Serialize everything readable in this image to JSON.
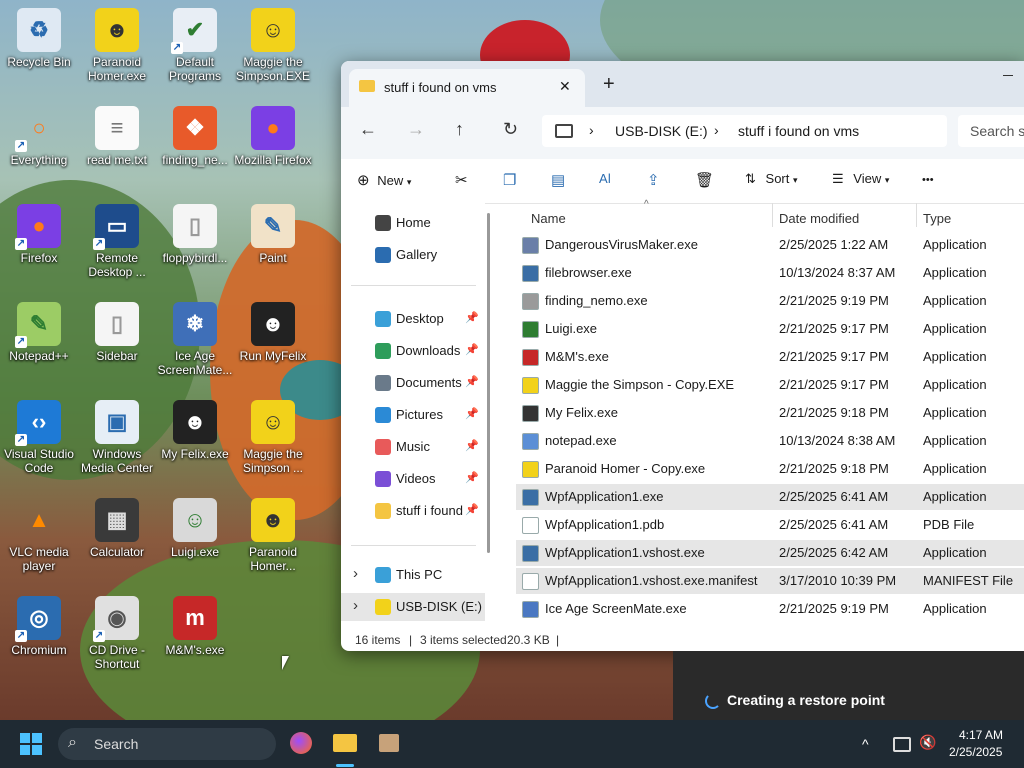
{
  "desktop": {
    "icons": [
      {
        "label": "Recycle Bin",
        "icon": "recycle-bin-icon"
      },
      {
        "label": "Paranoid Homer.exe",
        "icon": "homer-icon"
      },
      {
        "label": "Default Programs",
        "icon": "default-programs-icon"
      },
      {
        "label": "Maggie the Simpson.EXE",
        "icon": "maggie-icon"
      },
      {
        "label": "Everything",
        "icon": "magnifier-icon"
      },
      {
        "label": "read me.txt",
        "icon": "text-file-icon"
      },
      {
        "label": "finding_ne...",
        "icon": "nemo-icon"
      },
      {
        "label": "Mozilla Firefox",
        "icon": "firefox-icon"
      },
      {
        "label": "Firefox",
        "icon": "firefox-icon"
      },
      {
        "label": "Remote Desktop ...",
        "icon": "remote-desktop-icon"
      },
      {
        "label": "floppybirdl...",
        "icon": "file-icon"
      },
      {
        "label": "Paint",
        "icon": "paint-icon"
      },
      {
        "label": "Notepad++",
        "icon": "notepadpp-icon"
      },
      {
        "label": "Sidebar",
        "icon": "file-icon"
      },
      {
        "label": "Ice Age ScreenMate...",
        "icon": "ice-age-icon"
      },
      {
        "label": "Run MyFelix",
        "icon": "felix-icon"
      },
      {
        "label": "Visual Studio Code",
        "icon": "vscode-icon"
      },
      {
        "label": "Windows Media Center",
        "icon": "media-center-icon"
      },
      {
        "label": "My Felix.exe",
        "icon": "felix-icon"
      },
      {
        "label": "Maggie the Simpson ...",
        "icon": "maggie-icon"
      },
      {
        "label": "VLC media player",
        "icon": "vlc-icon"
      },
      {
        "label": "Calculator",
        "icon": "calculator-icon"
      },
      {
        "label": "Luigi.exe",
        "icon": "luigi-icon"
      },
      {
        "label": "Paranoid Homer...",
        "icon": "homer-icon"
      },
      {
        "label": "Chromium",
        "icon": "chromium-icon"
      },
      {
        "label": "CD Drive - Shortcut",
        "icon": "cd-drive-icon"
      },
      {
        "label": "M&M's.exe",
        "icon": "mms-icon"
      }
    ]
  },
  "explorer": {
    "tab_title": "stuff i found on vms",
    "tab_close": "✕",
    "new_tab": "+",
    "breadcrumb": [
      "USB-DISK (E:)",
      "stuff i found on vms"
    ],
    "search_placeholder": "Search st",
    "commands": {
      "new": "New",
      "sort": "Sort",
      "view": "View",
      "more": "•••"
    },
    "nav": [
      {
        "label": "Home",
        "pinned": false
      },
      {
        "label": "Gallery",
        "pinned": false
      },
      {
        "label": "Desktop",
        "pinned": true
      },
      {
        "label": "Downloads",
        "pinned": true
      },
      {
        "label": "Documents",
        "pinned": true
      },
      {
        "label": "Pictures",
        "pinned": true
      },
      {
        "label": "Music",
        "pinned": true
      },
      {
        "label": "Videos",
        "pinned": true
      },
      {
        "label": "stuff i found",
        "pinned": true
      },
      {
        "label": "This PC",
        "pinned": false
      },
      {
        "label": "USB-DISK (E:)",
        "pinned": false
      }
    ],
    "columns": {
      "name": "Name",
      "date": "Date modified",
      "type": "Type"
    },
    "files": [
      {
        "name": "DangerousVirusMaker.exe",
        "date": "2/25/2025 1:22 AM",
        "type": "Application",
        "selected": false,
        "color": "#6a7fa8"
      },
      {
        "name": "filebrowser.exe",
        "date": "10/13/2024 8:37 AM",
        "type": "Application",
        "selected": false,
        "color": "#3a6ea5"
      },
      {
        "name": "finding_nemo.exe",
        "date": "2/21/2025 9:19 PM",
        "type": "Application",
        "selected": false,
        "color": "#9a9a9a"
      },
      {
        "name": "Luigi.exe",
        "date": "2/21/2025 9:17 PM",
        "type": "Application",
        "selected": false,
        "color": "#2e7d32"
      },
      {
        "name": "M&M's.exe",
        "date": "2/21/2025 9:17 PM",
        "type": "Application",
        "selected": false,
        "color": "#c62828"
      },
      {
        "name": "Maggie the Simpson - Copy.EXE",
        "date": "2/21/2025 9:17 PM",
        "type": "Application",
        "selected": false,
        "color": "#f2d21a"
      },
      {
        "name": "My Felix.exe",
        "date": "2/21/2025 9:18 PM",
        "type": "Application",
        "selected": false,
        "color": "#333333"
      },
      {
        "name": "notepad.exe",
        "date": "10/13/2024 8:38 AM",
        "type": "Application",
        "selected": false,
        "color": "#5b8fd6"
      },
      {
        "name": "Paranoid Homer - Copy.exe",
        "date": "2/21/2025 9:18 PM",
        "type": "Application",
        "selected": false,
        "color": "#f2d21a"
      },
      {
        "name": "WpfApplication1.exe",
        "date": "2/25/2025 6:41 AM",
        "type": "Application",
        "selected": true,
        "color": "#3a6ea5"
      },
      {
        "name": "WpfApplication1.pdb",
        "date": "2/25/2025 6:41 AM",
        "type": "PDB File",
        "selected": false,
        "color": "#ffffff"
      },
      {
        "name": "WpfApplication1.vshost.exe",
        "date": "2/25/2025 6:42 AM",
        "type": "Application",
        "selected": true,
        "color": "#3a6ea5"
      },
      {
        "name": "WpfApplication1.vshost.exe.manifest",
        "date": "3/17/2010 10:39 PM",
        "type": "MANIFEST File",
        "selected": true,
        "color": "#ffffff"
      },
      {
        "name": "Ice Age ScreenMate.exe",
        "date": "2/21/2025 9:19 PM",
        "type": "Application",
        "selected": false,
        "color": "#4a78c2"
      }
    ],
    "status": {
      "count": "16 items",
      "selected": "3 items selected",
      "size": "20.3 KB"
    }
  },
  "restore": {
    "text": "Creating a restore point"
  },
  "taskbar": {
    "search_placeholder": "Search",
    "time": "4:17 AM",
    "date": "2/25/2025",
    "chevron": "^"
  }
}
